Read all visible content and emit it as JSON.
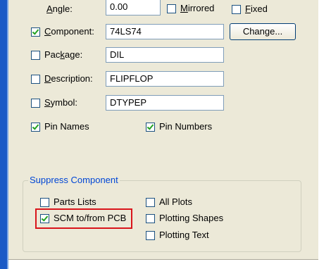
{
  "angle": {
    "label_pre": "",
    "label_u": "A",
    "label_post": "ngle:",
    "value": "0.00"
  },
  "mirrored": {
    "label_u": "M",
    "label_post": "irrored",
    "checked": false
  },
  "fixed": {
    "label_u": "F",
    "label_post": "ixed",
    "checked": false
  },
  "component": {
    "label_u": "C",
    "label_post": "omponent:",
    "value": "74LS74",
    "checked": true
  },
  "change_button": {
    "label": "Change..."
  },
  "package": {
    "label_pre": "Pac",
    "label_u": "k",
    "label_post": "age:",
    "value": "DIL",
    "checked": false
  },
  "description": {
    "label_u": "D",
    "label_post": "escription:",
    "value": "FLIPFLOP",
    "checked": false
  },
  "symbol": {
    "label_u": "S",
    "label_post": "ymbol:",
    "value": "DTYPEP",
    "checked": false
  },
  "pin_names": {
    "label": "Pin Names",
    "checked": true
  },
  "pin_numbers": {
    "label": "Pin Numbers",
    "checked": true
  },
  "suppress_group": {
    "title": "Suppress Component",
    "parts_lists": {
      "label": "Parts Lists",
      "checked": false
    },
    "scm_pcb": {
      "label": "SCM to/from PCB",
      "checked": true
    },
    "all_plots": {
      "label": "All Plots",
      "checked": false
    },
    "plotting_shapes": {
      "label": "Plotting Shapes",
      "checked": false
    },
    "plotting_text": {
      "label": "Plotting Text",
      "checked": false
    }
  },
  "colors": {
    "accent_border": "#1b5ac6",
    "highlight": "#d9151b",
    "group_title": "#0046d5"
  }
}
